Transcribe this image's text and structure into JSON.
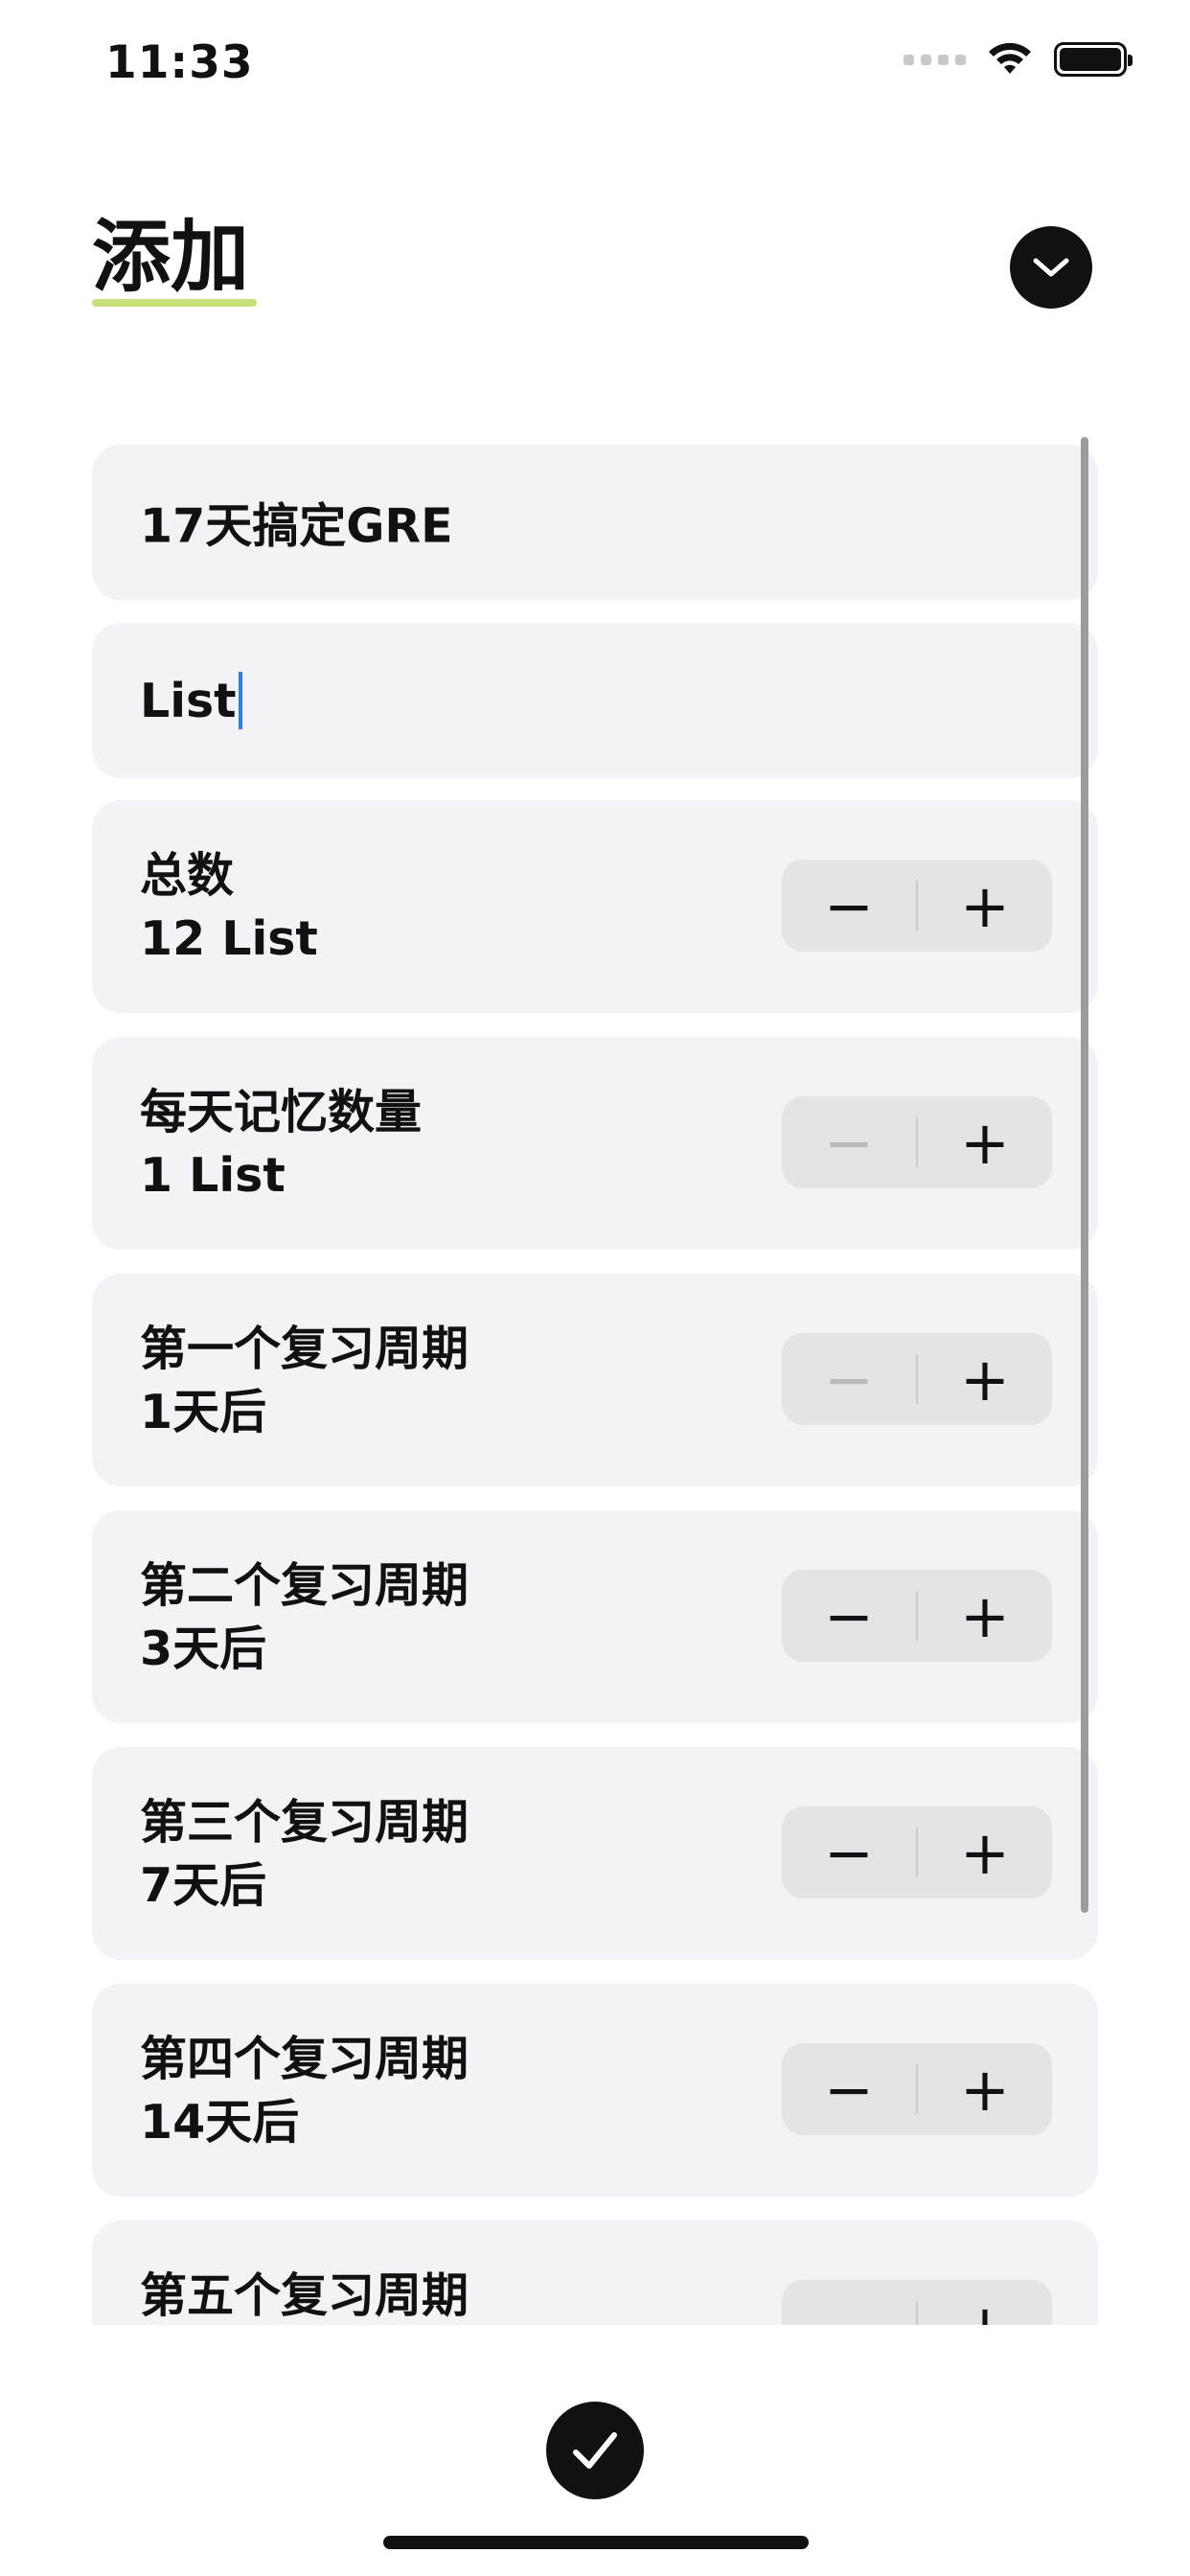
{
  "status_bar": {
    "time": "11:33"
  },
  "header": {
    "title": "添加",
    "collapse_icon": "chevron-down-icon"
  },
  "fields": {
    "name": {
      "value": "17天搞定GRE"
    },
    "unit": {
      "value": "List"
    }
  },
  "steppers": [
    {
      "id": "total",
      "label": "总数",
      "value": "12 List",
      "minus_enabled": true,
      "plus_enabled": true
    },
    {
      "id": "daily",
      "label": "每天记忆数量",
      "value": "1 List",
      "minus_enabled": false,
      "plus_enabled": true
    },
    {
      "id": "review1",
      "label": "第一个复习周期",
      "value": "1天后",
      "minus_enabled": false,
      "plus_enabled": true
    },
    {
      "id": "review2",
      "label": "第二个复习周期",
      "value": "3天后",
      "minus_enabled": true,
      "plus_enabled": true
    },
    {
      "id": "review3",
      "label": "第三个复习周期",
      "value": "7天后",
      "minus_enabled": true,
      "plus_enabled": true
    },
    {
      "id": "review4",
      "label": "第四个复习周期",
      "value": "14天后",
      "minus_enabled": true,
      "plus_enabled": true
    },
    {
      "id": "review5",
      "label": "第五个复习周期",
      "value": "",
      "minus_enabled": true,
      "plus_enabled": true
    }
  ],
  "stepper_symbols": {
    "minus": "−",
    "plus": "+"
  },
  "footer": {
    "confirm_icon": "checkmark-icon"
  },
  "colors": {
    "accent_underline": "#c8e07a",
    "card_bg": "#f2f2f7",
    "stepper_bg": "#e3e3e8",
    "caret": "#2f7bf6"
  }
}
